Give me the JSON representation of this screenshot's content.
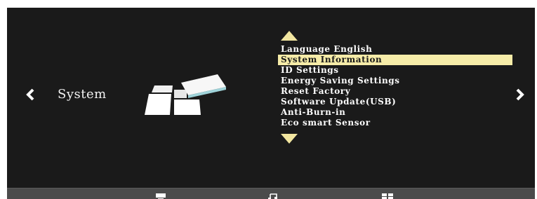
{
  "section": {
    "title": "System"
  },
  "menu": {
    "items": [
      "Language English",
      "System Information",
      "ID Settings",
      "Energy Saving Settings",
      "Reset Factory",
      "Software Update(USB)",
      "Anti-Burn-in",
      "Eco smart Sensor"
    ],
    "selected_index": 1
  },
  "icons": {
    "left_nav": "chevron-left-icon",
    "right_nav": "chevron-right-icon",
    "scroll_up": "triangle-up-icon",
    "scroll_down": "triangle-down-icon",
    "section_graphic": "system-tiles-icon",
    "bottom_bar": [
      "monitor-icon",
      "music-icon",
      "apps-grid-icon"
    ]
  },
  "colors": {
    "background": "#1a1a1a",
    "text": "#ffffff",
    "highlight": "#f6eca8",
    "accent_triangle": "#f2e6a0",
    "bottom_bar": "#4b4b4b"
  }
}
